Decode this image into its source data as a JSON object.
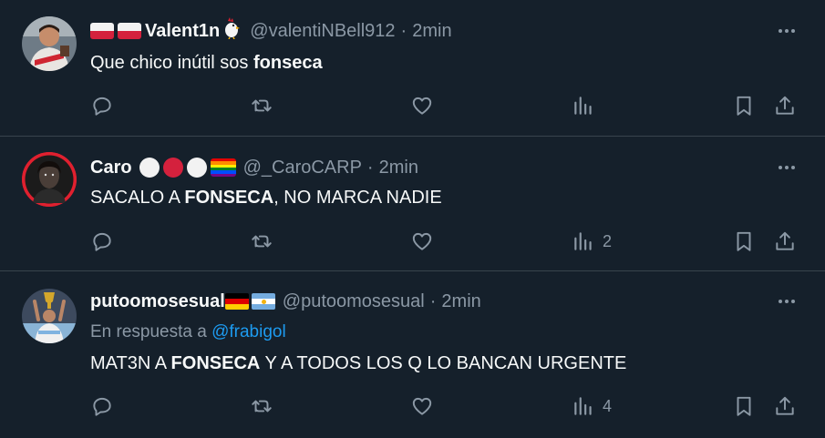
{
  "tweets": [
    {
      "name": "Valent1n",
      "name_emoji": "rooster",
      "handle": "@valentiNBell912",
      "time": "2min",
      "text_before": "Que chico inútil sos ",
      "text_bold": "fonseca",
      "text_after": "",
      "views": ""
    },
    {
      "name": "Caro",
      "handle": "@_CaroCARP",
      "time": "2min",
      "text_before": "SACALO A ",
      "text_bold": "FONSECA",
      "text_after": ", NO MARCA NADIE",
      "views": "2"
    },
    {
      "name": "putoomosesual",
      "handle": "@putoomosesual",
      "time": "2min",
      "reply_prefix": "En respuesta a ",
      "reply_mention": "@frabigol",
      "text_before": "MAT3N A ",
      "text_bold": "FONSECA",
      "text_after": " Y A TODOS LOS Q LO BANCAN URGENTE",
      "views": "4"
    }
  ],
  "separator": "·",
  "icons": [
    "more-icon",
    "reply-icon",
    "retweet-icon",
    "like-icon",
    "views-icon",
    "bookmark-icon",
    "share-icon"
  ],
  "colors": {
    "background": "#15202b",
    "divider": "#38444d",
    "text": "#f7f9f9",
    "muted": "#8b98a5",
    "link": "#1d9bf0"
  }
}
